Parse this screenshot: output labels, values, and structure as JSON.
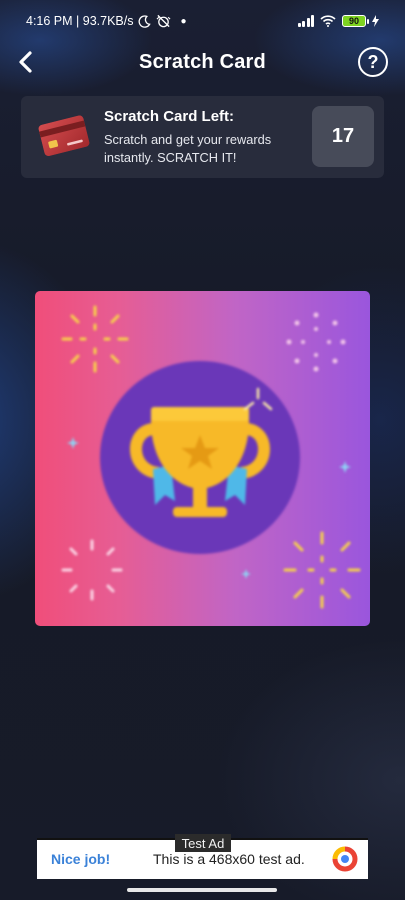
{
  "status_bar": {
    "time_speed": "4:16 PM | 93.7KB/s",
    "battery_level": "90"
  },
  "header": {
    "title": "Scratch Card",
    "help_glyph": "?"
  },
  "info_card": {
    "title": "Scratch Card Left:",
    "description": "Scratch and get your rewards instantly. SCRATCH IT!",
    "count": "17",
    "icon": "credit-card-icon"
  },
  "scratch_card": {
    "icon": "trophy-icon",
    "colors": {
      "left": "#f04e7a",
      "right": "#9a56dd",
      "circle": "#6a37b8",
      "trophy": "#f7b928",
      "ribbon": "#4fb8e8"
    }
  },
  "ad": {
    "label": "Test Ad",
    "nice_job": "Nice job!",
    "text": "This is a 468x60 test ad."
  }
}
